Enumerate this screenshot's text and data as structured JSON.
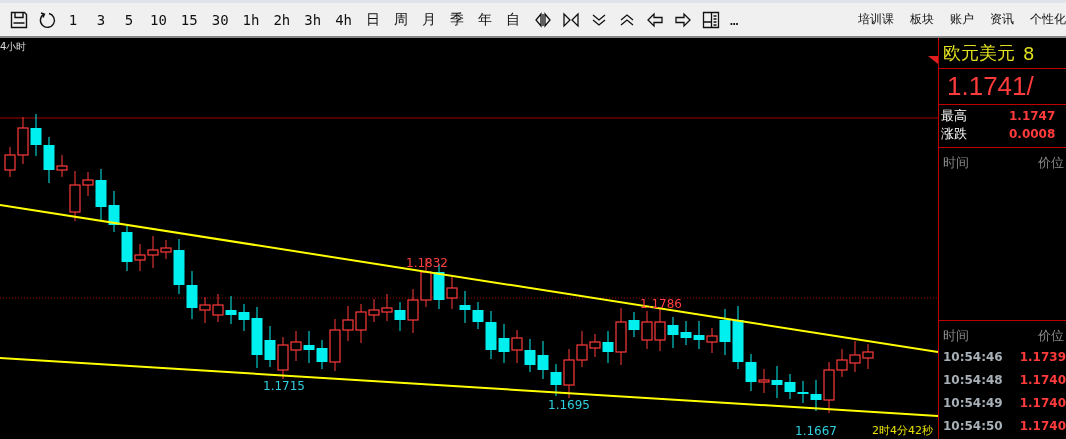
{
  "toolbar": {
    "periods": [
      {
        "label": "1"
      },
      {
        "label": "3"
      },
      {
        "label": "5"
      },
      {
        "label": "10"
      },
      {
        "label": "15"
      },
      {
        "label": "30"
      },
      {
        "label": "1h"
      },
      {
        "label": "2h"
      },
      {
        "label": "3h"
      },
      {
        "label": "4h"
      },
      {
        "label": "日"
      },
      {
        "label": "周"
      },
      {
        "label": "月"
      },
      {
        "label": "季"
      },
      {
        "label": "年"
      },
      {
        "label": "自"
      }
    ],
    "more": "…",
    "menu": [
      "培训课",
      "板块",
      "账户",
      "资讯",
      "个性化"
    ]
  },
  "chart": {
    "period_label": "4小时",
    "annotations": [
      {
        "text": "1.1832",
        "kind": "high"
      },
      {
        "text": "1.1786",
        "kind": "high"
      },
      {
        "text": "1.1715",
        "kind": "low"
      },
      {
        "text": "1.1695",
        "kind": "low"
      },
      {
        "text": "1.1667",
        "kind": "low"
      }
    ],
    "countdown": "2时4分42秒"
  },
  "quote": {
    "name": "欧元美元",
    "code": "8",
    "price": "1.1741/",
    "stats": [
      {
        "label": "最高",
        "value": "1.1747"
      },
      {
        "label": "涨跌",
        "value": "0.0008"
      }
    ],
    "columns": [
      "时间",
      "价位"
    ],
    "tick_columns": [
      "时间",
      "价位"
    ],
    "ticks": [
      {
        "time": "10:54:46",
        "price": "1.1739"
      },
      {
        "time": "10:54:48",
        "price": "1.1740"
      },
      {
        "time": "10:54:49",
        "price": "1.1740"
      },
      {
        "time": "10:54:50",
        "price": "1.1740"
      }
    ]
  }
}
